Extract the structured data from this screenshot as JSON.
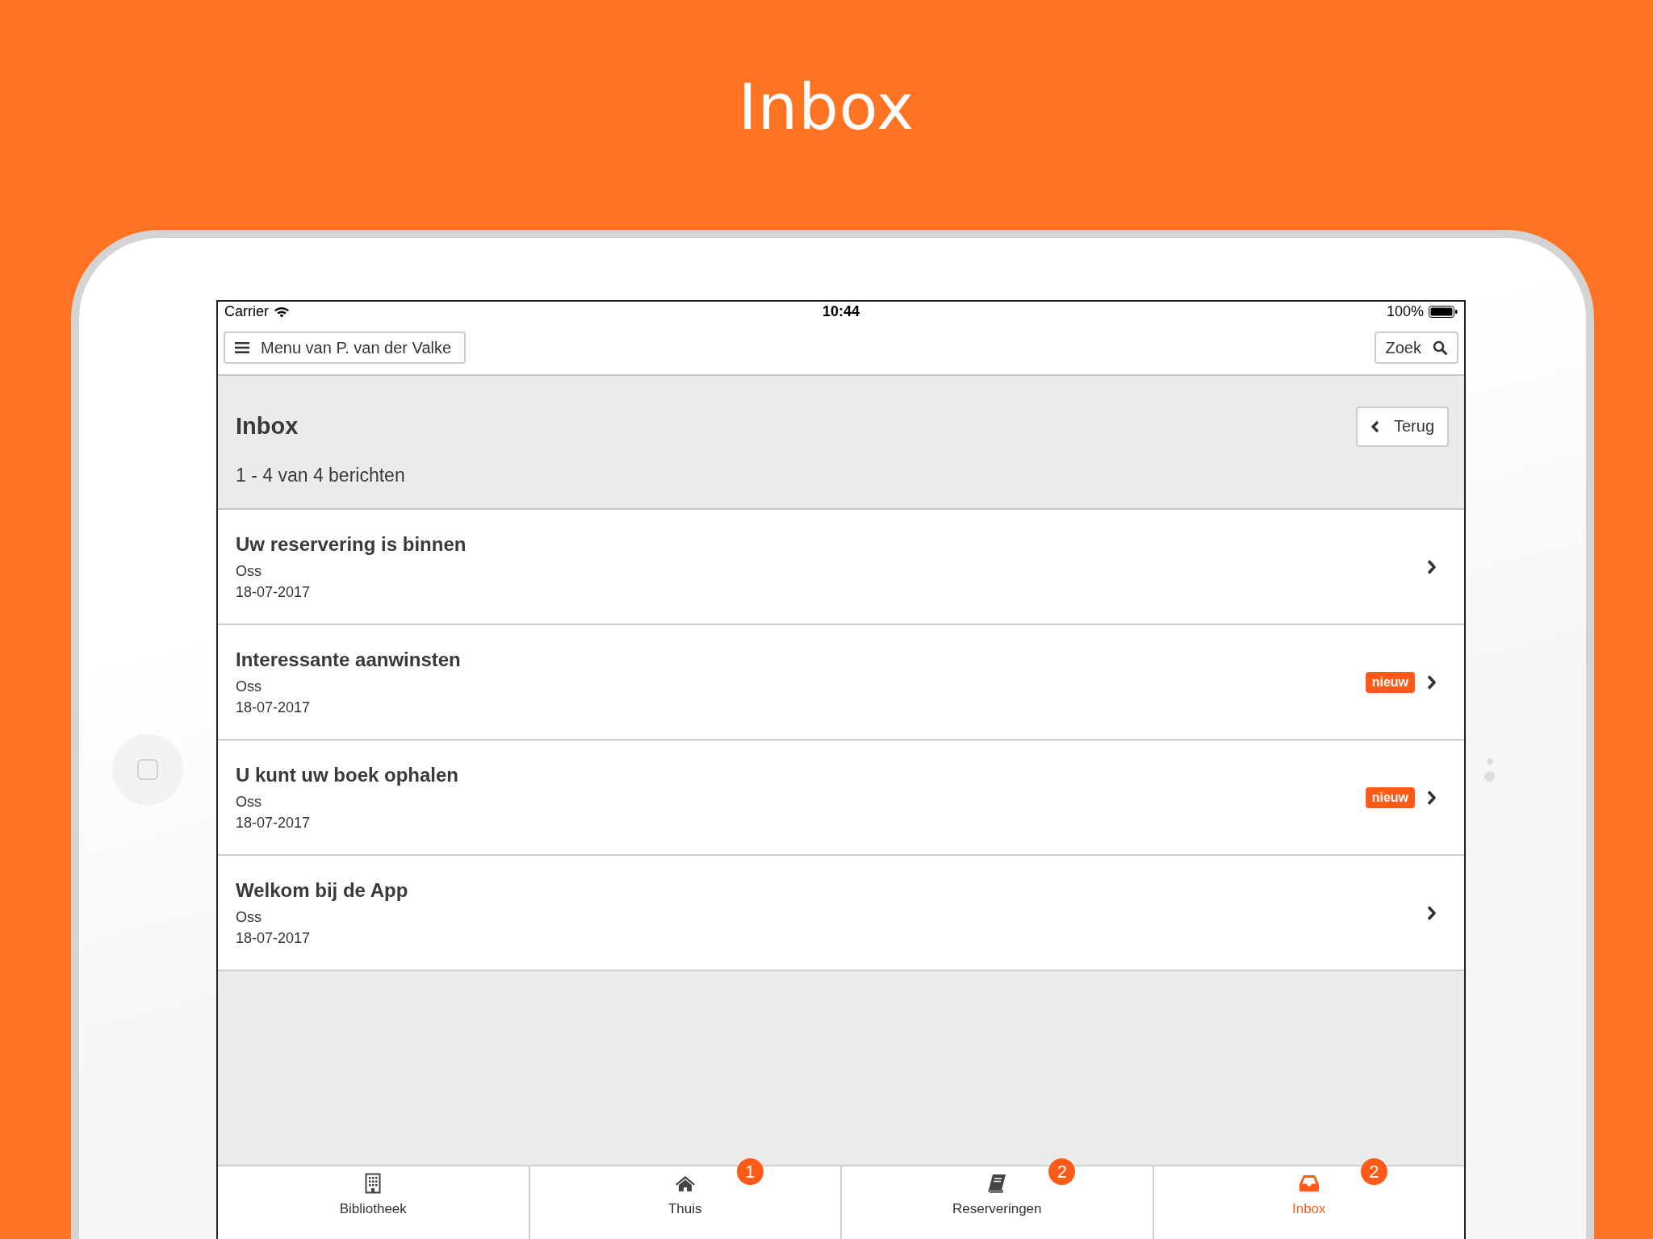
{
  "page_title": "Inbox",
  "status_bar": {
    "carrier": "Carrier",
    "time": "10:44",
    "battery": "100%"
  },
  "nav": {
    "menu_button": "Menu van P. van der Valke",
    "search_button": "Zoek"
  },
  "header": {
    "title": "Inbox",
    "back_button": "Terug",
    "count": "1 - 4 van 4 berichten"
  },
  "messages": [
    {
      "title": "Uw reservering is binnen",
      "location": "Oss",
      "date": "18-07-2017"
    },
    {
      "title": "Interessante aanwinsten",
      "location": "Oss",
      "date": "18-07-2017",
      "badge": "nieuw"
    },
    {
      "title": "U kunt uw boek ophalen",
      "location": "Oss",
      "date": "18-07-2017",
      "badge": "nieuw"
    },
    {
      "title": "Welkom bij de App",
      "location": "Oss",
      "date": "18-07-2017"
    }
  ],
  "tabs": [
    {
      "label": "Bibliotheek",
      "selected": false
    },
    {
      "label": "Thuis",
      "selected": false,
      "count": "1"
    },
    {
      "label": "Reserveringen",
      "selected": false,
      "count": "2"
    },
    {
      "label": "Inbox",
      "selected": true,
      "count": "2"
    }
  ]
}
